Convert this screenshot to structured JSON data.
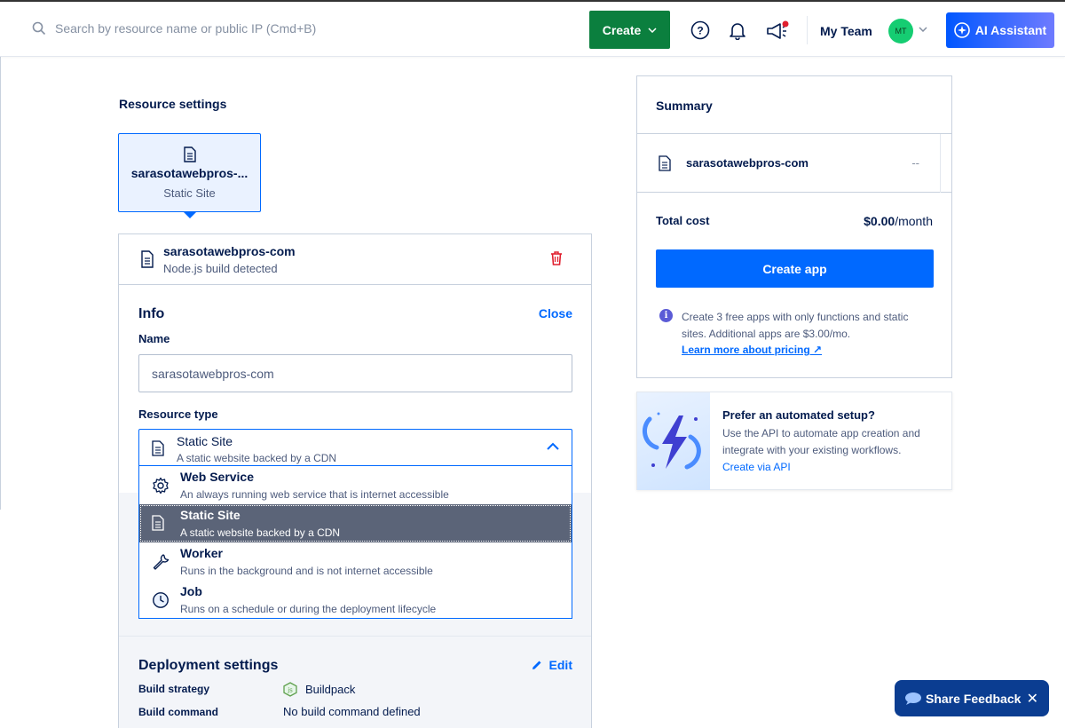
{
  "topbar": {
    "search_placeholder": "Search by resource name or public IP (Cmd+B)",
    "create_label": "Create",
    "team_label": "My Team",
    "avatar_initials": "MT",
    "ai_label": "AI Assistant"
  },
  "resource_settings": {
    "title": "Resource settings",
    "card_name": "sarasotawebpros-...",
    "card_type": "Static Site"
  },
  "component": {
    "name": "sarasotawebpros-com",
    "detected": "Node.js build detected"
  },
  "info": {
    "title": "Info",
    "close_label": "Close",
    "name_label": "Name",
    "name_value": "sarasotawebpros-com",
    "resource_type_label": "Resource type",
    "selected_type": "Static Site",
    "selected_desc": "A static website backed by a CDN"
  },
  "dropdown": {
    "options": [
      {
        "label": "Web Service",
        "desc": "An always running web service that is internet accessible",
        "icon": "gear-icon"
      },
      {
        "label": "Static Site",
        "desc": "A static website backed by a CDN",
        "icon": "document-icon"
      },
      {
        "label": "Worker",
        "desc": "Runs in the background and is not internet accessible",
        "icon": "wrench-icon"
      },
      {
        "label": "Job",
        "desc": "Runs on a schedule or during the deployment lifecycle",
        "icon": "clock-icon"
      }
    ]
  },
  "deployment": {
    "title": "Deployment settings",
    "edit_label": "Edit",
    "build_strategy_label": "Build strategy",
    "build_strategy_value": "Buildpack",
    "build_command_label": "Build command",
    "build_command_value": "No build command defined"
  },
  "summary": {
    "title": "Summary",
    "item_name": "sarasotawebpros-com",
    "item_cost": "--",
    "total_label": "Total cost",
    "total_amount": "$0.00",
    "total_unit": "/month",
    "create_app_label": "Create app",
    "note": "Create 3 free apps with only functions and static sites. Additional apps are $3.00/mo.",
    "note_link": "Learn more about pricing ↗"
  },
  "api_card": {
    "title": "Prefer an automated setup?",
    "text": "Use the API to automate app creation and integrate with your existing workflows.",
    "link": "Create via API"
  },
  "feedback": {
    "label": "Share Feedback",
    "close": "✕"
  },
  "colors": {
    "brand_blue": "#0069ff",
    "create_green": "#0b7f3e",
    "selected_option_bg": "#5b6478",
    "delete_red": "#e0202f"
  }
}
